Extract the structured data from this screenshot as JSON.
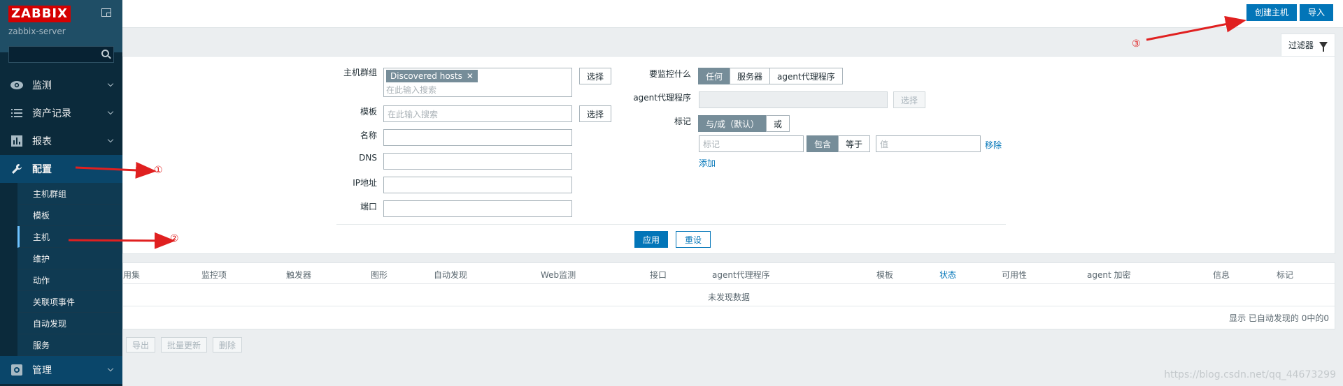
{
  "sidebar": {
    "logo": "ZABBIX",
    "server": "zabbix-server",
    "menu": [
      {
        "label": "监测",
        "icon": "eye-icon"
      },
      {
        "label": "资产记录",
        "icon": "list-icon"
      },
      {
        "label": "报表",
        "icon": "bar-chart-icon"
      },
      {
        "label": "配置",
        "icon": "wrench-icon"
      }
    ],
    "submenu": [
      "主机群组",
      "模板",
      "主机",
      "维护",
      "动作",
      "关联项事件",
      "自动发现",
      "服务"
    ],
    "admin": {
      "label": "管理",
      "icon": "gear-icon"
    }
  },
  "header": {
    "create_label": "创建主机",
    "import_label": "导入",
    "filter_tab": "过滤器"
  },
  "filter": {
    "hostgroup_label": "主机群组",
    "hostgroup_chip": "Discovered hosts",
    "hostgroup_placeholder": "在此输入搜索",
    "select_label": "选择",
    "template_label": "模板",
    "template_placeholder": "在此输入搜索",
    "name_label": "名称",
    "dns_label": "DNS",
    "ip_label": "IP地址",
    "port_label": "端口",
    "monitor_label": "要监控什么",
    "monitor_options": [
      "任何",
      "服务器",
      "agent代理程序"
    ],
    "proxy_label": "agent代理程序",
    "tags_label": "标记",
    "tags_options": [
      "与/或（默认）",
      "或"
    ],
    "tag_placeholder": "标记",
    "tag_ops": [
      "包含",
      "等于"
    ],
    "value_placeholder": "值",
    "remove_label": "移除",
    "add_label": "添加",
    "apply_label": "应用",
    "reset_label": "重设"
  },
  "table": {
    "columns": [
      "用集",
      "监控项",
      "触发器",
      "图形",
      "自动发现",
      "Web监测",
      "接口",
      "agent代理程序",
      "模板",
      "状态",
      "可用性",
      "agent 加密",
      "信息",
      "标记"
    ],
    "empty": "未发现数据",
    "count": "显示 已自动发现的 0中的0"
  },
  "actions": [
    "导出",
    "批量更新",
    "删除"
  ],
  "annotations": [
    "①",
    "②",
    "③"
  ],
  "watermark": "https://blog.csdn.net/qq_44673299",
  "colors": {
    "accent": "#0275b8",
    "sidebar": "#0b2a3b",
    "arrow": "#e02020"
  }
}
